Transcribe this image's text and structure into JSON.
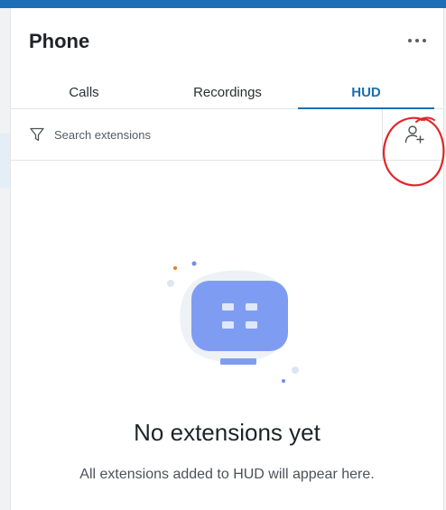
{
  "header": {
    "title": "Phone",
    "more_icon": "more-horizontal-icon"
  },
  "tabs": [
    {
      "label": "Calls",
      "active": false
    },
    {
      "label": "Recordings",
      "active": false
    },
    {
      "label": "HUD",
      "active": true
    }
  ],
  "search": {
    "placeholder": "Search extensions",
    "value": "",
    "filter_icon": "filter-icon",
    "add_icon": "add-user-icon"
  },
  "empty_state": {
    "title": "No extensions yet",
    "subtitle": "All extensions added to HUD will appear here.",
    "illustration_icon": "extension-device-icon"
  },
  "colors": {
    "accent": "#1d6fae",
    "top_bar": "#1c6fb5",
    "illustration": "#7e9df2",
    "annotation": "#e0262b"
  }
}
